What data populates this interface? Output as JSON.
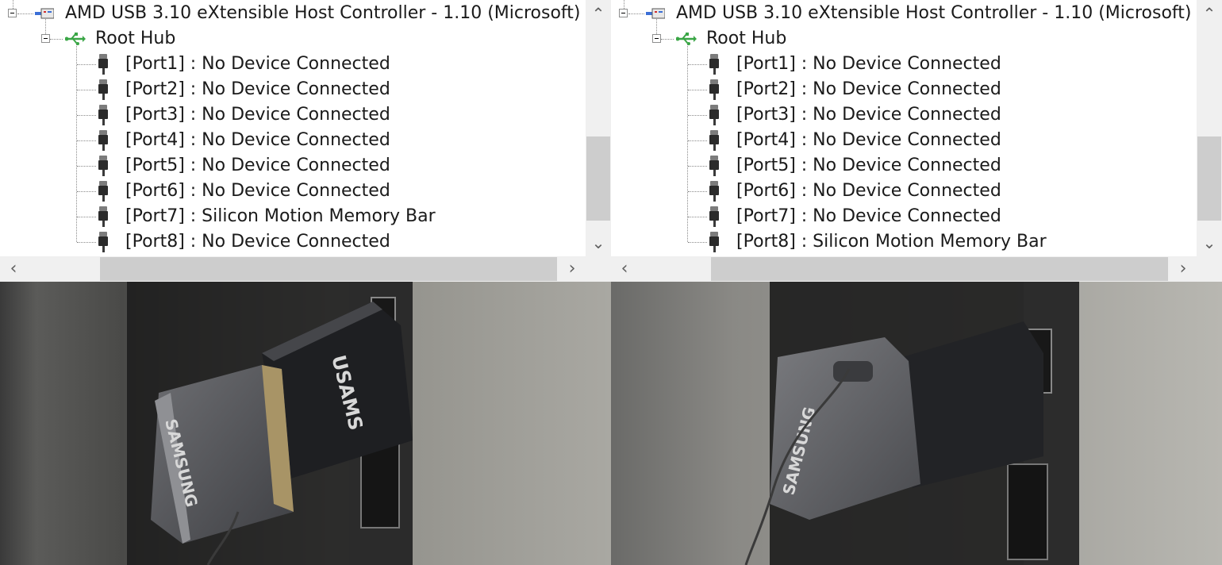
{
  "left": {
    "controller": "AMD USB 3.10 eXtensible Host Controller - 1.10 (Microsoft)",
    "hub": "Root Hub",
    "ports": [
      "[Port1] : No Device Connected",
      "[Port2] : No Device Connected",
      "[Port3] : No Device Connected",
      "[Port4] : No Device Connected",
      "[Port5] : No Device Connected",
      "[Port6] : No Device Connected",
      "[Port7] : Silicon Motion Memory Bar",
      "[Port8] : No Device Connected"
    ],
    "photo": {
      "drive_brand": "SAMSUNG",
      "extension_brand": "USAMS"
    }
  },
  "right": {
    "controller": "AMD USB 3.10 eXtensible Host Controller - 1.10 (Microsoft)",
    "hub": "Root Hub",
    "ports": [
      "[Port1] : No Device Connected",
      "[Port2] : No Device Connected",
      "[Port3] : No Device Connected",
      "[Port4] : No Device Connected",
      "[Port5] : No Device Connected",
      "[Port6] : No Device Connected",
      "[Port7] : No Device Connected",
      "[Port8] : Silicon Motion Memory Bar"
    ],
    "photo": {
      "drive_brand": "SAMSUNG"
    }
  },
  "icons": {
    "expander": "collapse-minus-icon",
    "controller": "usb-controller-icon",
    "hub": "usb-hub-icon",
    "port": "usb-port-icon",
    "scroll_up": "chevron-up-icon",
    "scroll_down": "chevron-down-icon",
    "scroll_left": "chevron-left-icon",
    "scroll_right": "chevron-right-icon"
  },
  "colors": {
    "tree_background": "#ffffff",
    "scrollbar_track": "#f0f0f0",
    "scrollbar_thumb": "#cdcdcd",
    "usb_hub_green": "#3aa646",
    "controller_blue": "#3b6fd6"
  }
}
